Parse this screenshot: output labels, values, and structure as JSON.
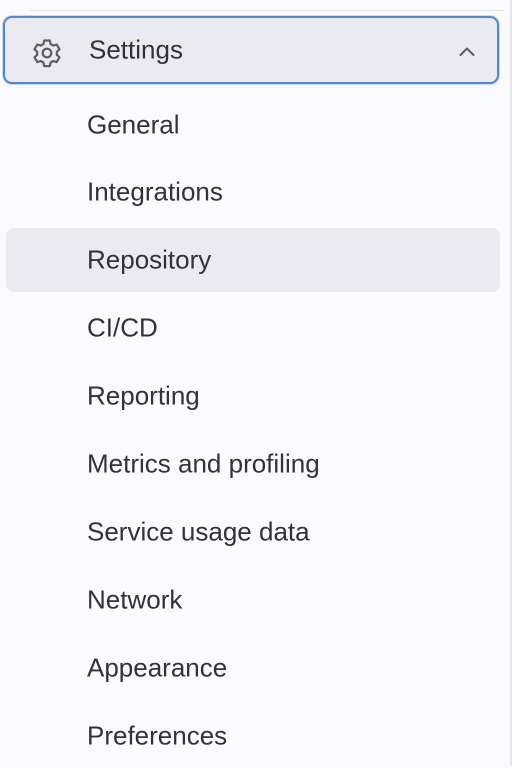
{
  "sidebar": {
    "section": {
      "label": "Settings",
      "icon": "gear-icon",
      "expanded": true,
      "toggle_icon": "chevron-up-icon"
    },
    "items": [
      {
        "label": "General",
        "active": false
      },
      {
        "label": "Integrations",
        "active": false
      },
      {
        "label": "Repository",
        "active": true
      },
      {
        "label": "CI/CD",
        "active": false
      },
      {
        "label": "Reporting",
        "active": false
      },
      {
        "label": "Metrics and profiling",
        "active": false
      },
      {
        "label": "Service usage data",
        "active": false
      },
      {
        "label": "Network",
        "active": false
      },
      {
        "label": "Appearance",
        "active": false
      },
      {
        "label": "Preferences",
        "active": false
      }
    ]
  },
  "colors": {
    "focus_ring": "#4f88d8",
    "active_bg": "#ebeaf0",
    "text": "#333238",
    "background": "#fbfafd"
  }
}
